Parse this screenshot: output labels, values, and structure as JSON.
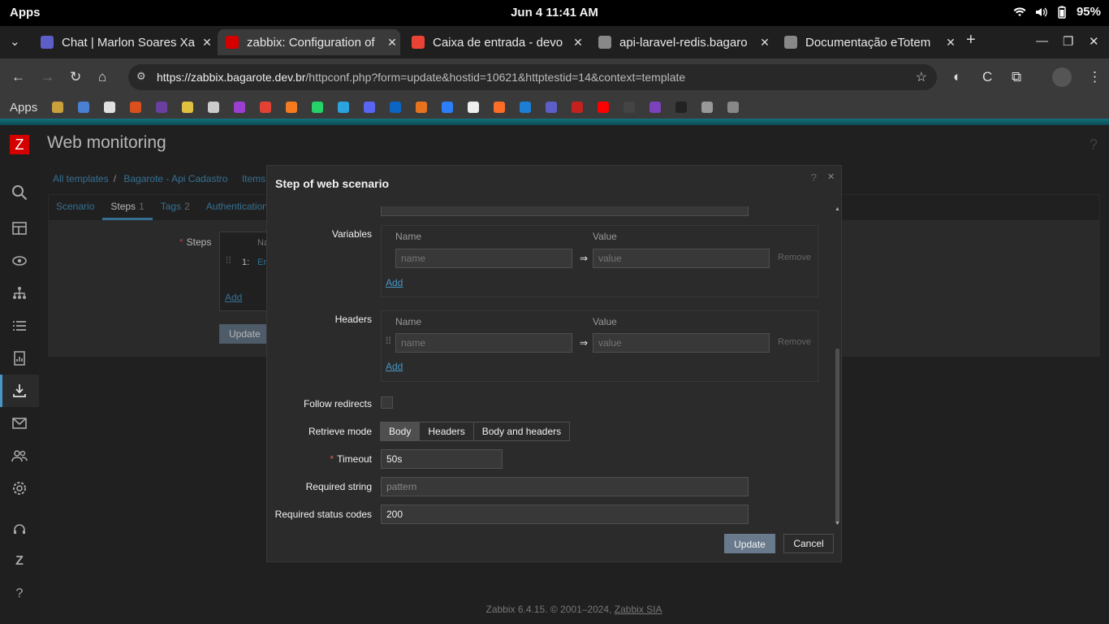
{
  "os": {
    "apps_label": "Apps",
    "clock": "Jun 4  11:41 AM",
    "battery": "95%"
  },
  "browser": {
    "tabs": [
      {
        "title": "Chat | Marlon Soares Xa",
        "favicon": "teams-icon",
        "color": "#5b5fc7",
        "active": false
      },
      {
        "title": "zabbix: Configuration of",
        "favicon": "zabbix-icon",
        "color": "#d40000",
        "active": true
      },
      {
        "title": "Caixa de entrada - devo",
        "favicon": "gmail-icon",
        "color": "#ea4335",
        "active": false
      },
      {
        "title": "api-laravel-redis.bagaro",
        "favicon": "globe-icon",
        "color": "#888888",
        "active": false
      },
      {
        "title": "Documentação eTotem",
        "favicon": "globe-icon",
        "color": "#888888",
        "active": false
      }
    ],
    "url_host": "https://zabbix.bagarote.dev.br",
    "url_path": "/httpconf.php?form=update&hostid=10621&httptestid=14&context=template",
    "bookmarks_label": "Apps",
    "bookmark_colors": [
      "#c8a03c",
      "#4a7fd1",
      "#e0e0e0",
      "#d9501e",
      "#6b3fa0",
      "#e0c040",
      "#cccccc",
      "#9b3fd0",
      "#e34133",
      "#f47b20",
      "#25d366",
      "#2aa3df",
      "#5865f2",
      "#0a66c2",
      "#e8731e",
      "#2d7ff9",
      "#eeeeee",
      "#fc6d26",
      "#1b7fd6",
      "#5b5fc7",
      "#c5221f",
      "#ff0000",
      "#444444",
      "#7b42bc",
      "#222222",
      "#999999",
      "#888888"
    ]
  },
  "zabbix": {
    "page_title": "Web monitoring",
    "help": "?",
    "breadcrumb": [
      "All templates",
      "Bagarote - Api Cadastro",
      "Items"
    ],
    "tabs": [
      {
        "label": "Scenario",
        "count": ""
      },
      {
        "label": "Steps",
        "count": "1"
      },
      {
        "label": "Tags",
        "count": "2"
      },
      {
        "label": "Authentication",
        "count": ""
      }
    ],
    "steps_label": "Steps",
    "steps_col_name": "Na",
    "step_row_num": "1:",
    "step_row_name": "En",
    "steps_add": "Add",
    "update_button": "Update",
    "footer_text": "Zabbix 6.4.15. © 2001–2024,",
    "footer_link": "Zabbix SIA"
  },
  "dialog": {
    "title": "Step of web scenario",
    "help": "?",
    "close": "×",
    "variables": {
      "label": "Variables",
      "col_name": "Name",
      "col_value": "Value",
      "name_placeholder": "name",
      "value_placeholder": "value",
      "arrow": "⇒",
      "remove": "Remove",
      "add": "Add"
    },
    "headers": {
      "label": "Headers",
      "col_name": "Name",
      "col_value": "Value",
      "name_placeholder": "name",
      "value_placeholder": "value",
      "arrow": "⇒",
      "remove": "Remove",
      "add": "Add"
    },
    "follow_redirects_label": "Follow redirects",
    "follow_redirects_checked": false,
    "retrieve_mode_label": "Retrieve mode",
    "retrieve_modes": [
      "Body",
      "Headers",
      "Body and headers"
    ],
    "retrieve_mode_selected": "Body",
    "timeout_label": "Timeout",
    "timeout_value": "50s",
    "required_string_label": "Required string",
    "required_string_placeholder": "pattern",
    "required_status_label": "Required status codes",
    "required_status_value": "200",
    "update_label": "Update",
    "cancel_label": "Cancel"
  }
}
